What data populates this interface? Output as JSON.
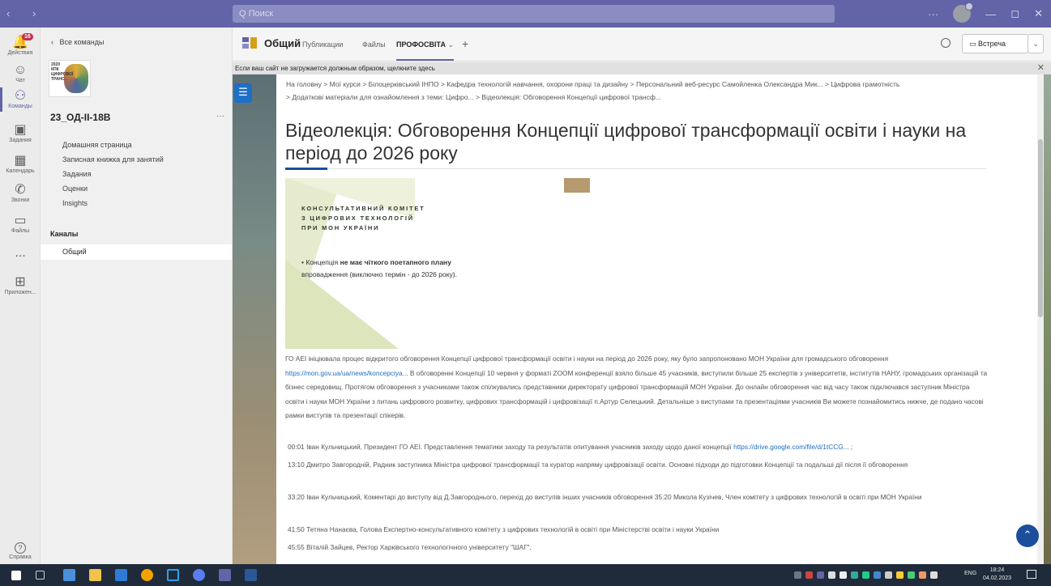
{
  "titlebar": {
    "search_placeholder": "Q Поиск",
    "more": "···",
    "controls": [
      "—",
      "◻",
      "✕"
    ]
  },
  "rail": [
    {
      "label": "Действия",
      "icon": "bell-icon",
      "badge": "16"
    },
    {
      "label": "Чат",
      "icon": "chat-icon"
    },
    {
      "label": "Команды",
      "icon": "teams-icon",
      "active": true
    },
    {
      "label": "Задания",
      "icon": "assignments-icon"
    },
    {
      "label": "Календарь",
      "icon": "calendar-icon"
    },
    {
      "label": "Звонки",
      "icon": "phone-icon"
    },
    {
      "label": "Файлы",
      "icon": "files-icon"
    },
    {
      "label": "...",
      "icon": "more-icon"
    },
    {
      "label": "Приложен...",
      "icon": "apps-icon"
    }
  ],
  "help_label": "Справка",
  "team": {
    "back_label": "Все команды",
    "logo_text": "2020 КПК ПЕРЕВОЗИЛИ ЦИФРОВОЇ ТРАНСФОРМАЦІЇ",
    "name": "23_ОД-ІІ-18В",
    "more": "···",
    "menu": [
      "Домашняя страница",
      "Записная книжка для занятий",
      "Задания",
      "Оценки",
      "Insights"
    ],
    "channels_header": "Каналы",
    "channel": "Общий"
  },
  "header": {
    "title": "Общий",
    "tabs": [
      "Публикации",
      "Файлы",
      "ПРОФОСВІТА"
    ],
    "selected_tab_caret": "⌄",
    "add_tab": "+",
    "meet_label": "Встреча",
    "meet_caret": "⌄"
  },
  "notice": {
    "text": "Если ваш сайт не загружается должным образом, щелкните здесь",
    "close": "✕"
  },
  "page": {
    "breadcrumb_line1": "На головну > Мої курси > Білоцерківський ІНПО > Кафедра технологій навчання, охорони праці та дизайну > Персональний веб-ресурс Самойленка Олександра Мик... > Цифрова грамотність",
    "breadcrumb_line2": "> Додаткові матеріали для ознайомлення з теми: Цифро... > Відеолекція: Обговорення Концепції цифрової трансф...",
    "title": "Відеолекція: Обговорення Концепції цифрової трансформації освіти і науки на період до 2026 року",
    "slide": {
      "title_line1": "КОНСУЛЬТАТИВНИЙ КОМІТЕТ",
      "title_line2": "З ЦИФРОВИХ ТЕХНОЛОГІЙ",
      "title_line3": "ПРИ МОН УКРАЇНИ",
      "bullet_pre": "• Концепція",
      "bullet_bold": "не має чіткого поетапного плану",
      "bullet_post": "впровадження (виключно термін - до 2026 року)."
    },
    "intro_text_a": "ГО АЕІ ініціювала процес відкритого обговорення Концепції цифрової трансформації освіти і науки на період до 2026 року, яку було запропоновано МОН України для громадського обговорення",
    "intro_link": "https://mon.gov.ua/ua/news/koncepciya...",
    "intro_text_b": "В обговоренні Концепції 10 червня у форматі ZOOM конференції взяло більше 45 учасників, виступили більше 25 експертів з університетів, інститутів НАНУ, громадських організацій та бізнес середовищ. Протягом обговорення з учасниками також спілкувались представники директорату цифрової трансформацій МОН України. До онлайн обговорення час від часу також підключався заступник Міністра освіти і науки МОН України з питань цифрового розвитку, цифрових трансформацій і цифровізації п.Артур Селецький. Детальніше з виступами та презентаціями учасників Ви можете познайомитись нижче, де подано часові рамки виступів та презентації спікерів.",
    "timestamps": [
      {
        "text": "00:01 Іван Кульчицький, Президент ГО АЕІ. Представлення тематики заходу та результатів опитування учасників заходу щодо даної концепції",
        "link": "https://drive.google.com/file/d/1tCCG...",
        "suffix": " ;"
      },
      {
        "text": "13:10 Дмитро Завгородній, Радник заступника Міністра цифрової трансформації та куратор напряму цифровізації освіти. Основні підходи до підготовки Концепції та подальші дії після її обговорення"
      },
      {
        "text": "33:20 Іван Кульчицький, Коментарі до виступу від Д.Завгороднього, перехід до виступів інших учасників обговорення 35:20 Микола Кузічев, Член комітету з цифрових технологій в освіті при МОН України"
      },
      {
        "text": "41:50 Тетяна Нанаєва, Голова Експертно-консультативного комітету з цифрових технологій в освіті при Міністерстві освіти і науки України"
      },
      {
        "text": "45:55 Віталій Зайцев, Ректор Харківського технологічного університету \"ШАГ\","
      }
    ]
  },
  "taskbar": {
    "lang": "ENG",
    "time": "18:24",
    "date": "04.02.2023"
  },
  "colors": {
    "brand": "#6264a7",
    "page_accent": "#1b4f9c",
    "link": "#1b6fc2",
    "badge": "#c4314b"
  }
}
